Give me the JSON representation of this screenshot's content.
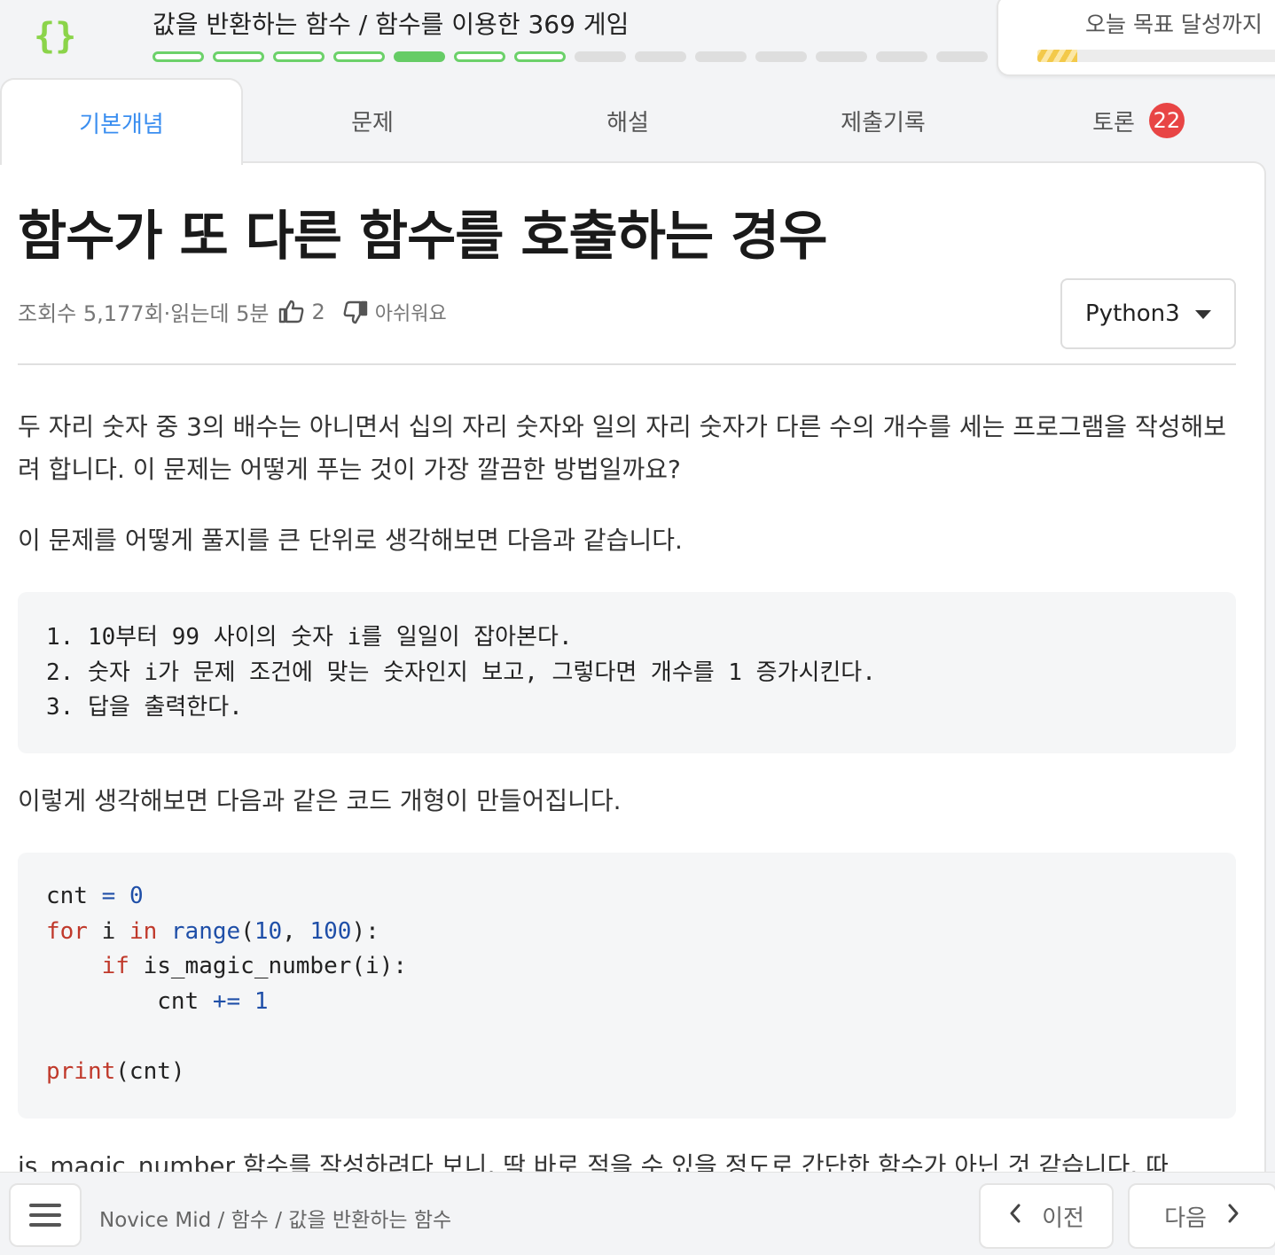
{
  "header": {
    "logo_glyph": "{}",
    "title": "값을 반환하는 함수 / 함수를 이용한 369 게임",
    "progress": {
      "total": 14,
      "completed": 7,
      "current_index": 4
    },
    "goal": {
      "label": "오늘 목표 달성까지",
      "progress_fraction": 0.15
    }
  },
  "tabs": [
    {
      "label": "기본개념",
      "active": true
    },
    {
      "label": "문제",
      "active": false
    },
    {
      "label": "해설",
      "active": false
    },
    {
      "label": "제출기록",
      "active": false
    },
    {
      "label": "토론",
      "active": false,
      "badge": "22"
    }
  ],
  "article": {
    "title": "함수가 또 다른 함수를 호출하는 경우",
    "meta": {
      "views_text": "조회수 5,177회·읽는데 5분",
      "likes": "2",
      "dislike_label": "아쉬워요"
    },
    "language": "Python3",
    "para1": "두 자리 숫자 중 3의 배수는 아니면서 십의 자리 숫자와 일의 자리 숫자가 다른 수의 개수를 세는 프로그램을 작성해보려 합니다. 이 문제는 어떻게 푸는 것이 가장 깔끔한 방법일까요?",
    "para2": "이 문제를 어떻게 풀지를 큰 단위로 생각해보면 다음과 같습니다.",
    "steps": [
      "1. 10부터 99 사이의 숫자 i를 일일이 잡아본다.",
      "2. 숫자 i가 문제 조건에 맞는 숫자인지 보고, 그렇다면 개수를 1 증가시킨다.",
      "3. 답을 출력한다."
    ],
    "para3": "이렇게 생각해보면 다음과 같은 코드 개형이 만들어집니다.",
    "code": {
      "l1": [
        "cnt ",
        "=",
        " ",
        "0"
      ],
      "l2": [
        "for",
        " i ",
        "in",
        " ",
        "range",
        "(",
        "10",
        ", ",
        "100",
        "):"
      ],
      "l3": [
        "    ",
        "if",
        " is_magic_number(i):"
      ],
      "l4": [
        "        cnt ",
        "+=",
        " ",
        "1"
      ],
      "l6": [
        "print",
        "(cnt)"
      ]
    },
    "para4": "is_magic_number 함수를 작성하려다 보니, 딱 바로 적을 수 있을 정도로 간단한 함수가 아닌 것 같습니다. 따"
  },
  "bottom": {
    "breadcrumb": "Novice Mid / 함수 / 값을 반환하는 함수",
    "prev_label": "이전",
    "next_label": "다음"
  },
  "colors": {
    "accent_blue": "#3a8ef0",
    "progress_green": "#66cc66",
    "badge_red": "#e84545",
    "keyword_red": "#c0392b",
    "number_blue": "#1f4fa8"
  }
}
